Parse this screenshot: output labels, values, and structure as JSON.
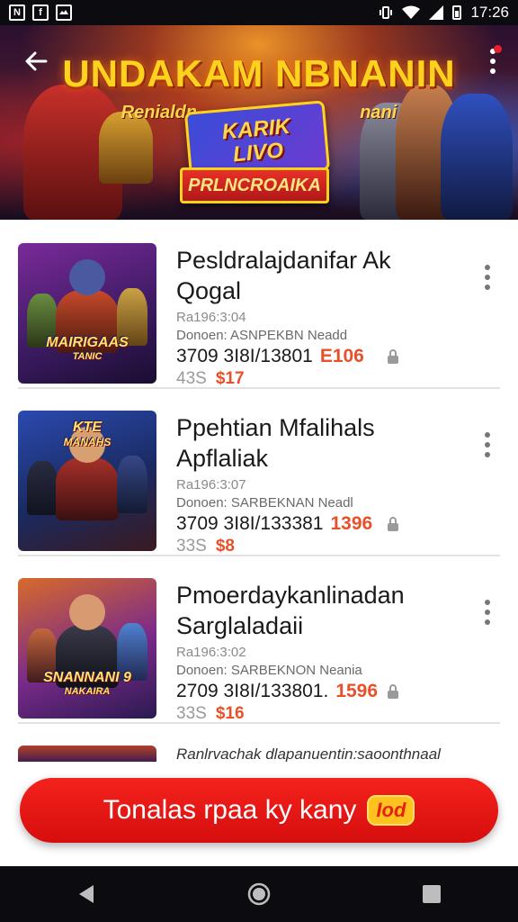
{
  "status_bar": {
    "time": "17:26",
    "left_icons": [
      "N",
      "f",
      "image"
    ]
  },
  "banner": {
    "title": "UNDAKAM NBNANIN",
    "subtitle_left": "Renialdn",
    "subtitle_right": "nani",
    "logo_line1": "KARIK",
    "logo_line2": "LIVO",
    "ribbon": "PRLNCROAIKA"
  },
  "items": [
    {
      "title_line1": "Pesldralajdanifar Ak",
      "title_line2": "Qogal",
      "date": "Ra196:3:04",
      "meta": "Donoen: ASNPEKBN Neadd",
      "code": "3709 3I8I/13801",
      "price_red": "E106",
      "old_price": "43S",
      "sale_price": "$17",
      "thumb_label_1": "MAIRIGAAS",
      "thumb_label_2": "TANIC"
    },
    {
      "title_line1": "Ppehtian Mfalihals",
      "title_line2": "Apflaliak",
      "date": "Ra196:3:07",
      "meta": "Donoen: SARBEKNAN Neadl",
      "code": "3709 3I8I/133381",
      "price_red": "1396",
      "old_price": "33S",
      "sale_price": "$8",
      "thumb_label_1": "KTE",
      "thumb_label_2": "MANAHS"
    },
    {
      "title_line1": "Pmoerdaykanlinadan",
      "title_line2": "Sarglaladaii",
      "date": "Ra196:3:02",
      "meta": "Donoen: SARBEKNON Neania",
      "code": "2709 3I8I/133801.",
      "price_red": "1596",
      "old_price": "33S",
      "sale_price": "$16",
      "thumb_label_1": "SNANNANI 9",
      "thumb_label_2": "NAKAIRA"
    }
  ],
  "partial_item_text": "Ranlrvachak dlapanuentin:saoonthnaal",
  "cta": {
    "label": "Tonalas rpaa ky kany",
    "badge": "Iod"
  },
  "colors": {
    "accent_red": "#e8202a",
    "price_red": "#e8502a",
    "banner_gold": "#ffd21e"
  },
  "icons": {
    "back": "arrow-left-icon",
    "more": "more-vert-icon",
    "lock": "lock-icon",
    "nav_back": "triangle-back-icon",
    "nav_home": "circle-home-icon",
    "nav_recent": "square-recent-icon"
  }
}
